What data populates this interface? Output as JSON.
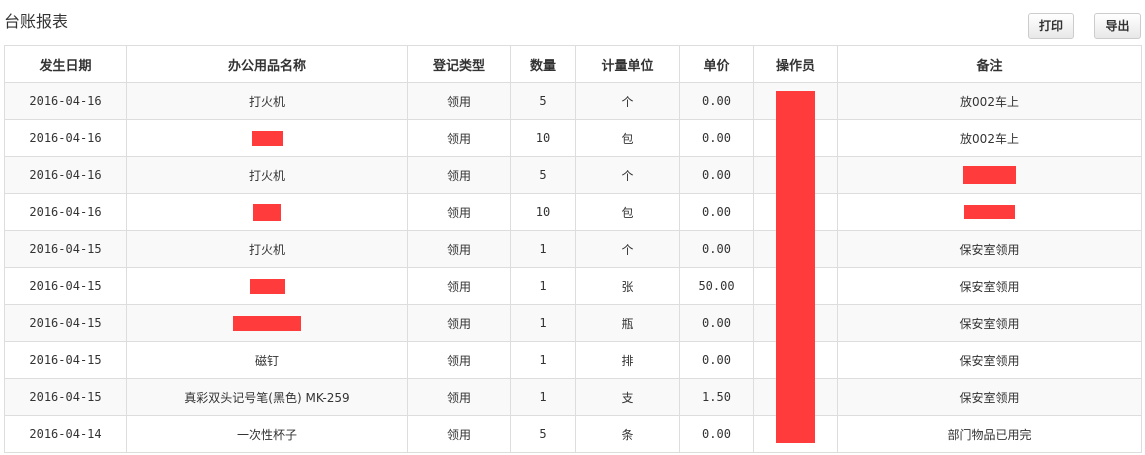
{
  "page": {
    "title": "台账报表"
  },
  "toolbar": {
    "print_label": "打印",
    "export_label": "导出"
  },
  "colors": {
    "redaction": "#ff3b3b",
    "border": "#dddddd",
    "stripe": "#f9f9f9"
  },
  "table": {
    "headers": {
      "date": "发生日期",
      "name": "办公用品名称",
      "type": "登记类型",
      "qty": "数量",
      "unit": "计量单位",
      "price": "单价",
      "operator": "操作员",
      "remark": "备注"
    },
    "rows": [
      {
        "date": "2016-04-16",
        "name": "打火机",
        "type": "领用",
        "qty": "5",
        "unit": "个",
        "price": "0.00",
        "remark": "放002车上"
      },
      {
        "date": "2016-04-16",
        "name": "",
        "type": "领用",
        "qty": "10",
        "unit": "包",
        "price": "0.00",
        "remark": "放002车上"
      },
      {
        "date": "2016-04-16",
        "name": "打火机",
        "type": "领用",
        "qty": "5",
        "unit": "个",
        "price": "0.00",
        "remark": ""
      },
      {
        "date": "2016-04-16",
        "name": "",
        "type": "领用",
        "qty": "10",
        "unit": "包",
        "price": "0.00",
        "remark": ""
      },
      {
        "date": "2016-04-15",
        "name": "打火机",
        "type": "领用",
        "qty": "1",
        "unit": "个",
        "price": "0.00",
        "remark": "保安室领用"
      },
      {
        "date": "2016-04-15",
        "name": "",
        "type": "领用",
        "qty": "1",
        "unit": "张",
        "price": "50.00",
        "remark": "保安室领用"
      },
      {
        "date": "2016-04-15",
        "name": "",
        "type": "领用",
        "qty": "1",
        "unit": "瓶",
        "price": "0.00",
        "remark": "保安室领用"
      },
      {
        "date": "2016-04-15",
        "name": "磁钉",
        "type": "领用",
        "qty": "1",
        "unit": "排",
        "price": "0.00",
        "remark": "保安室领用"
      },
      {
        "date": "2016-04-15",
        "name": "真彩双头记号笔(黑色) MK-259",
        "type": "领用",
        "qty": "1",
        "unit": "支",
        "price": "1.50",
        "remark": "保安室领用"
      },
      {
        "date": "2016-04-14",
        "name": "一次性杯子",
        "type": "领用",
        "qty": "5",
        "unit": "条",
        "price": "0.00",
        "remark": "部门物品已用完"
      }
    ]
  }
}
